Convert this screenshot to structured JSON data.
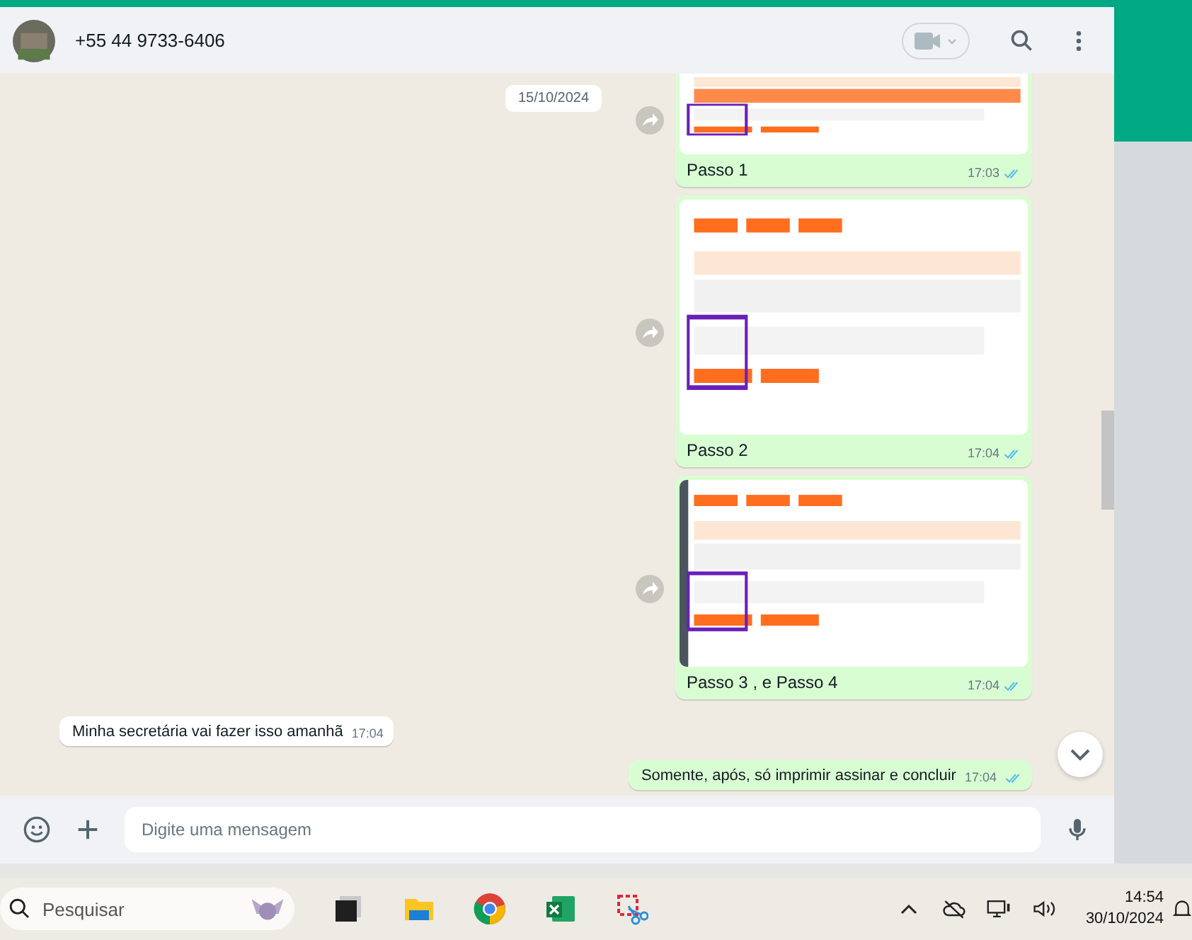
{
  "contact": {
    "name": "+55 44 9733-6406"
  },
  "date_chip": "15/10/2024",
  "messages": [
    {
      "incoming": false,
      "caption": "Passo 1",
      "time": "17:03",
      "read": true
    },
    {
      "incoming": false,
      "caption": "Passo 2",
      "time": "17:04",
      "read": true
    },
    {
      "incoming": false,
      "caption": "Passo 3 , e Passo 4",
      "time": "17:04",
      "read": true
    },
    {
      "kind": "text",
      "incoming": true,
      "text": "Minha secretária vai fazer isso amanhã",
      "time": "17:04"
    },
    {
      "kind": "text",
      "incoming": false,
      "text": "Somente, após, só imprimir assinar e concluir",
      "time": "17:04",
      "read": true
    }
  ],
  "composer": {
    "placeholder": "Digite uma mensagem"
  },
  "taskbar": {
    "search_placeholder": "Pesquisar",
    "time": "14:54",
    "date": "30/10/2024"
  }
}
